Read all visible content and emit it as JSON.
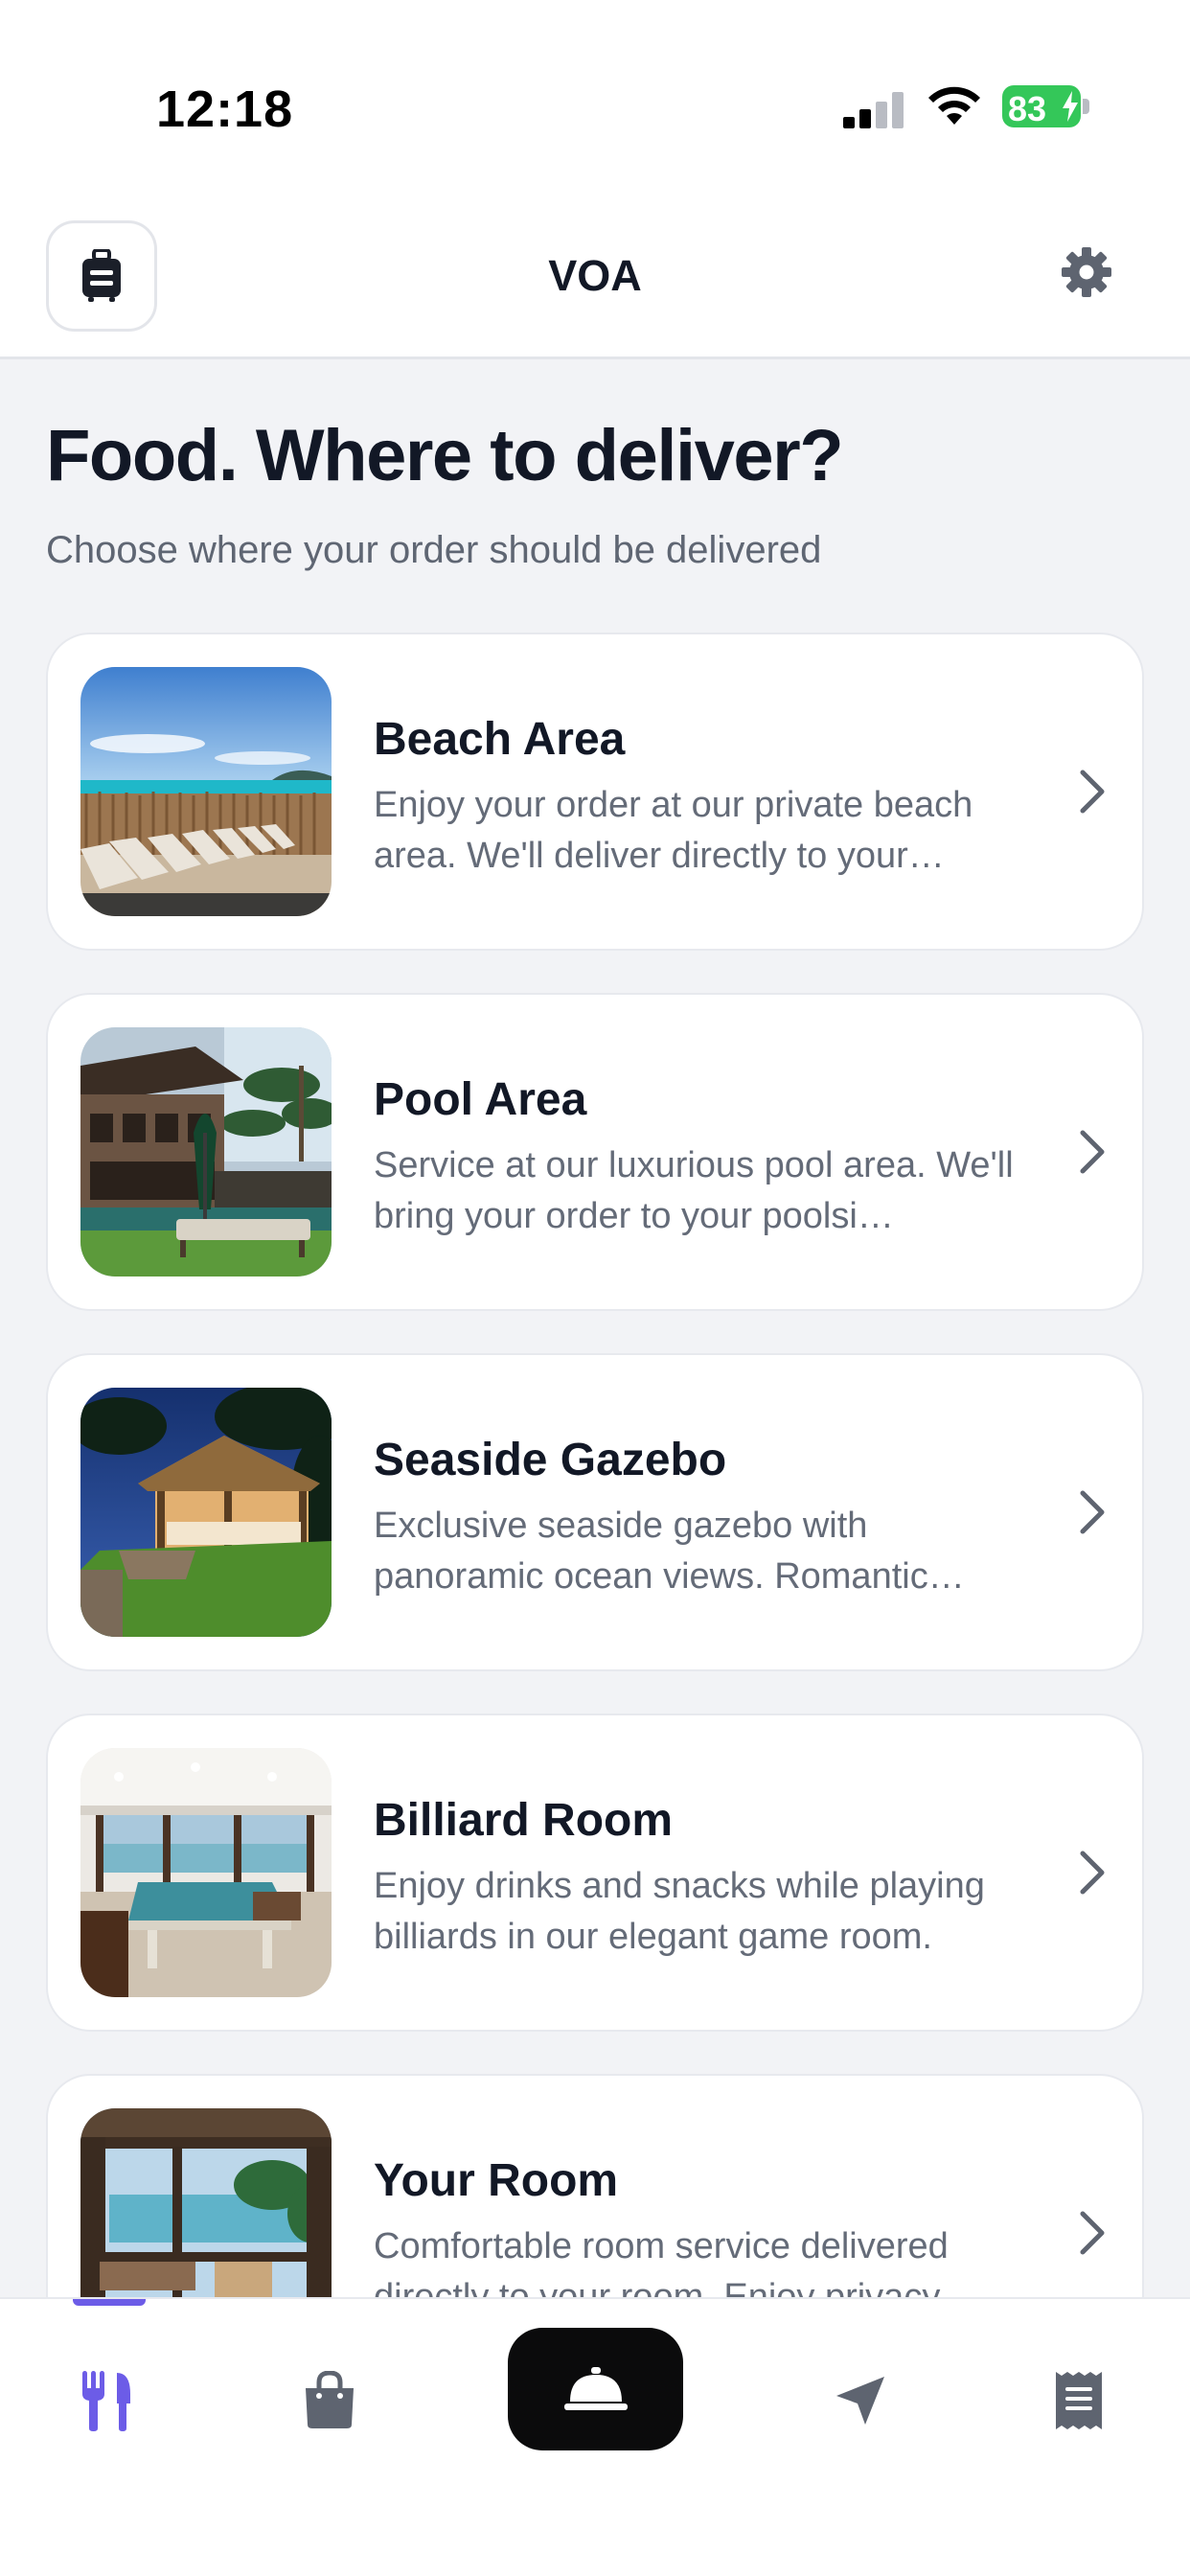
{
  "status_bar": {
    "time": "12:18",
    "battery": "83"
  },
  "header": {
    "title": "VOA",
    "left_icon": "luggage-icon",
    "right_icon": "gear-icon"
  },
  "page": {
    "title": "Food. Where to deliver?",
    "subtitle": "Choose where your order should be delivered"
  },
  "locations": [
    {
      "name": "Beach Area",
      "description": "Enjoy your order at our private beach area. We'll deliver directly to your…",
      "image": "beach-loungers-photo"
    },
    {
      "name": "Pool Area",
      "description": "Service at our luxurious pool area. We'll bring your order to your poolsi…",
      "image": "pool-villa-photo"
    },
    {
      "name": "Seaside Gazebo",
      "description": "Exclusive seaside gazebo with panoramic ocean views. Romantic…",
      "image": "gazebo-night-photo"
    },
    {
      "name": "Billiard Room",
      "description": "Enjoy drinks and snacks while playing billiards in our elegant game room.",
      "image": "billiard-room-photo"
    },
    {
      "name": "Your Room",
      "description": "Comfortable room service delivered directly to your room. Enjoy privacy…",
      "image": "room-terrace-photo"
    }
  ],
  "tabs": [
    {
      "icon": "fork-knife-icon",
      "active": true
    },
    {
      "icon": "shopping-bag-icon",
      "active": false
    },
    {
      "icon": "service-bell-icon",
      "active": false,
      "highlighted": true
    },
    {
      "icon": "location-arrow-icon",
      "active": false
    },
    {
      "icon": "receipt-icon",
      "active": false
    }
  ],
  "colors": {
    "accent": "#6c5ce7",
    "battery_green": "#34c759",
    "background": "#f2f3f6",
    "text_primary": "#121826",
    "text_secondary": "#646b78"
  }
}
